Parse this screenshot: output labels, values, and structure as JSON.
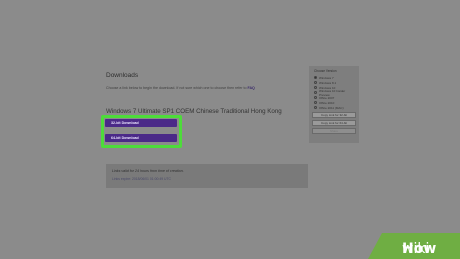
{
  "page": {
    "downloads_title": "Downloads",
    "description": "Choose a link below to begin the download. If not sure which one to choose then refer to",
    "faq_link": "FAQ",
    "product_title": "Windows 7 Ultimate SP1 COEM Chinese Traditional Hong Kong",
    "btn_32": "32-bit Download",
    "btn_64": "64-bit Download",
    "notice_line1": "Links valid for 24 hours from time of creation.",
    "notice_line2": "Links expire: 2018/06/01 01:00:49 UTC"
  },
  "side": {
    "title": "Choose Version",
    "options": [
      {
        "label": "Windows 7",
        "selected": true
      },
      {
        "label": "Windows 8.1",
        "selected": false
      },
      {
        "label": "Windows 10",
        "selected": false
      },
      {
        "label": "Windows 10 Insider Preview",
        "selected": false
      },
      {
        "label": "Office 2007",
        "selected": false
      },
      {
        "label": "Office 2010",
        "selected": false
      },
      {
        "label": "Office 2011 (MAC)",
        "selected": false
      }
    ],
    "copy_32": "Copy Link for 32-bit",
    "copy_64": "Copy Link for 64-bit",
    "share": "Share"
  },
  "watermark": {
    "brand_prefix": "wiki",
    "brand_suffix": "How"
  },
  "colors": {
    "accent": "#4b2a88",
    "highlight": "#4ddc3a",
    "brand": "#6fae43"
  }
}
